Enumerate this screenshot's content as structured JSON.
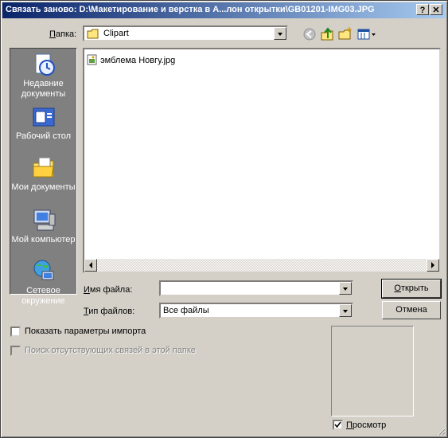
{
  "window": {
    "title": "Связать заново: D:\\Макетирование и верстка в А...лон открытки\\GB01201-IMG03.JPG",
    "help_button": "?",
    "close_button": "✕"
  },
  "lookin": {
    "label_prefix": "П",
    "label_rest": "апка:",
    "value": "Clipart"
  },
  "places": [
    {
      "label": "Недавние документы",
      "icon": "recent-documents-icon"
    },
    {
      "label": "Рабочий стол",
      "icon": "desktop-icon"
    },
    {
      "label": "Мои документы",
      "icon": "my-documents-icon"
    },
    {
      "label": "Мой компьютер",
      "icon": "my-computer-icon"
    },
    {
      "label": "Сетевое окружение",
      "icon": "network-icon"
    }
  ],
  "files": [
    {
      "name": "эмблема Новгу.jpg"
    }
  ],
  "filename": {
    "label_prefix": "И",
    "label_rest": "мя файла:",
    "value": ""
  },
  "filetype": {
    "label_prefix": "Т",
    "label_rest": "ип файлов:",
    "value": "Все файлы"
  },
  "buttons": {
    "open_prefix": "О",
    "open_rest": "ткрыть",
    "cancel": "Отмена"
  },
  "options": {
    "show_import": "Показать параметры импорта",
    "search_missing": "Поиск отсутствующих связей в этой папке",
    "preview_prefix": "П",
    "preview_rest": "росмотр",
    "preview_checked": true
  },
  "colors": {
    "title_start": "#0a246a",
    "title_end": "#a6caf0",
    "face": "#d4d0c8",
    "places_bg": "#808080"
  }
}
